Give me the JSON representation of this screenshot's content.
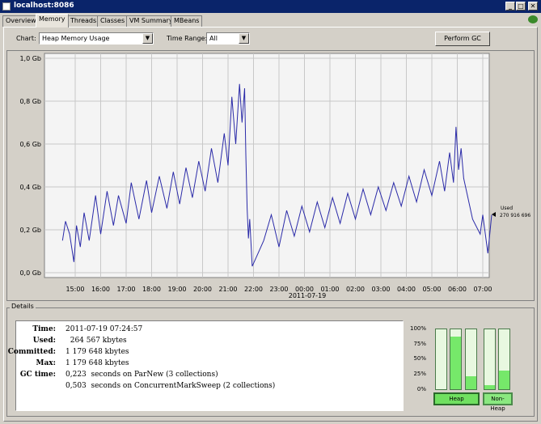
{
  "window": {
    "title": "localhost:8086",
    "buttons": [
      "_",
      "□",
      "✕"
    ]
  },
  "tabs": [
    "Overview",
    "Memory",
    "Threads",
    "Classes",
    "VM Summary",
    "MBeans"
  ],
  "active_tab": "Memory",
  "toolbar": {
    "chart_label": "Chart:",
    "chart_value": "Heap Memory Usage",
    "range_label": "Time Range:",
    "range_value": "All",
    "perform_gc": "Perform GC"
  },
  "used_label": {
    "title": "Used",
    "value": "270 916 696"
  },
  "details": {
    "title": "Details",
    "rows": [
      {
        "key": "Time:",
        "value": "2011-07-19 07:24:57"
      },
      {
        "key": "Used:",
        "value": "  264 567 kbytes"
      },
      {
        "key": "Committed:",
        "value": "1 179 648 kbytes"
      },
      {
        "key": "Max:",
        "value": "1 179 648 kbytes"
      },
      {
        "key": "GC time:",
        "value": "0,223  seconds on ParNew (3 collections)"
      },
      {
        "key": "",
        "value": "0,503  seconds on ConcurrentMarkSweep (2 collections)"
      }
    ]
  },
  "meters": {
    "ticks": [
      "100%",
      "75%",
      "50%",
      "25%",
      "0%"
    ],
    "heap_label": "Heap",
    "nonheap_label": "Non-Heap",
    "heap": [
      0.0,
      0.88,
      0.22
    ],
    "nonheap": [
      0.07,
      0.31
    ],
    "fill_color": "#76e86a"
  },
  "chart_data": {
    "type": "line",
    "y_ticks": [
      "1,0 Gb",
      "0,8 Gb",
      "0,6 Gb",
      "0,4 Gb",
      "0,2 Gb",
      "0,0 Gb"
    ],
    "x_ticks": [
      "15:00",
      "16:00",
      "17:00",
      "18:00",
      "19:00",
      "20:00",
      "21:00",
      "22:00",
      "23:00",
      "00:00",
      "01:00",
      "02:00",
      "03:00",
      "04:00",
      "05:00",
      "06:00",
      "07:00"
    ],
    "date_label": "2011-07-19",
    "ylim": [
      0,
      1.0
    ],
    "grid": true,
    "line_color": "#2a2aa8",
    "series": [
      {
        "x": [
          14.5,
          14.62,
          14.78,
          14.95,
          15.05,
          15.2,
          15.35,
          15.55,
          15.8,
          16.0,
          16.25,
          16.5,
          16.7,
          17.0,
          17.2,
          17.5,
          17.8,
          18.0,
          18.3,
          18.6,
          18.85,
          19.1,
          19.35,
          19.6,
          19.85,
          20.1,
          20.35,
          20.6,
          20.85,
          21.0,
          21.15,
          21.3,
          21.45,
          21.55,
          21.65,
          21.7,
          21.75,
          21.8,
          21.85,
          21.95,
          22.1,
          22.4,
          22.7,
          23.0,
          23.3,
          23.6,
          23.9,
          24.2,
          24.5,
          24.8,
          25.1,
          25.4,
          25.7,
          26.0,
          26.3,
          26.6,
          26.9,
          27.2,
          27.5,
          27.8,
          28.1,
          28.4,
          28.7,
          29.0,
          29.3,
          29.5,
          29.7,
          29.85,
          29.95,
          30.05,
          30.15,
          30.25,
          30.6,
          30.9,
          31.0,
          31.2,
          31.35
        ],
        "y": [
          0.15,
          0.24,
          0.18,
          0.05,
          0.22,
          0.12,
          0.28,
          0.15,
          0.36,
          0.18,
          0.38,
          0.22,
          0.36,
          0.23,
          0.42,
          0.25,
          0.43,
          0.28,
          0.45,
          0.3,
          0.47,
          0.32,
          0.49,
          0.35,
          0.52,
          0.38,
          0.58,
          0.42,
          0.65,
          0.5,
          0.82,
          0.6,
          0.88,
          0.7,
          0.86,
          0.55,
          0.3,
          0.16,
          0.25,
          0.03,
          0.07,
          0.15,
          0.27,
          0.12,
          0.29,
          0.17,
          0.31,
          0.19,
          0.33,
          0.21,
          0.35,
          0.23,
          0.37,
          0.25,
          0.39,
          0.27,
          0.4,
          0.29,
          0.42,
          0.31,
          0.45,
          0.33,
          0.48,
          0.36,
          0.52,
          0.38,
          0.56,
          0.42,
          0.68,
          0.48,
          0.58,
          0.44,
          0.25,
          0.18,
          0.27,
          0.09,
          0.27
        ]
      }
    ]
  }
}
